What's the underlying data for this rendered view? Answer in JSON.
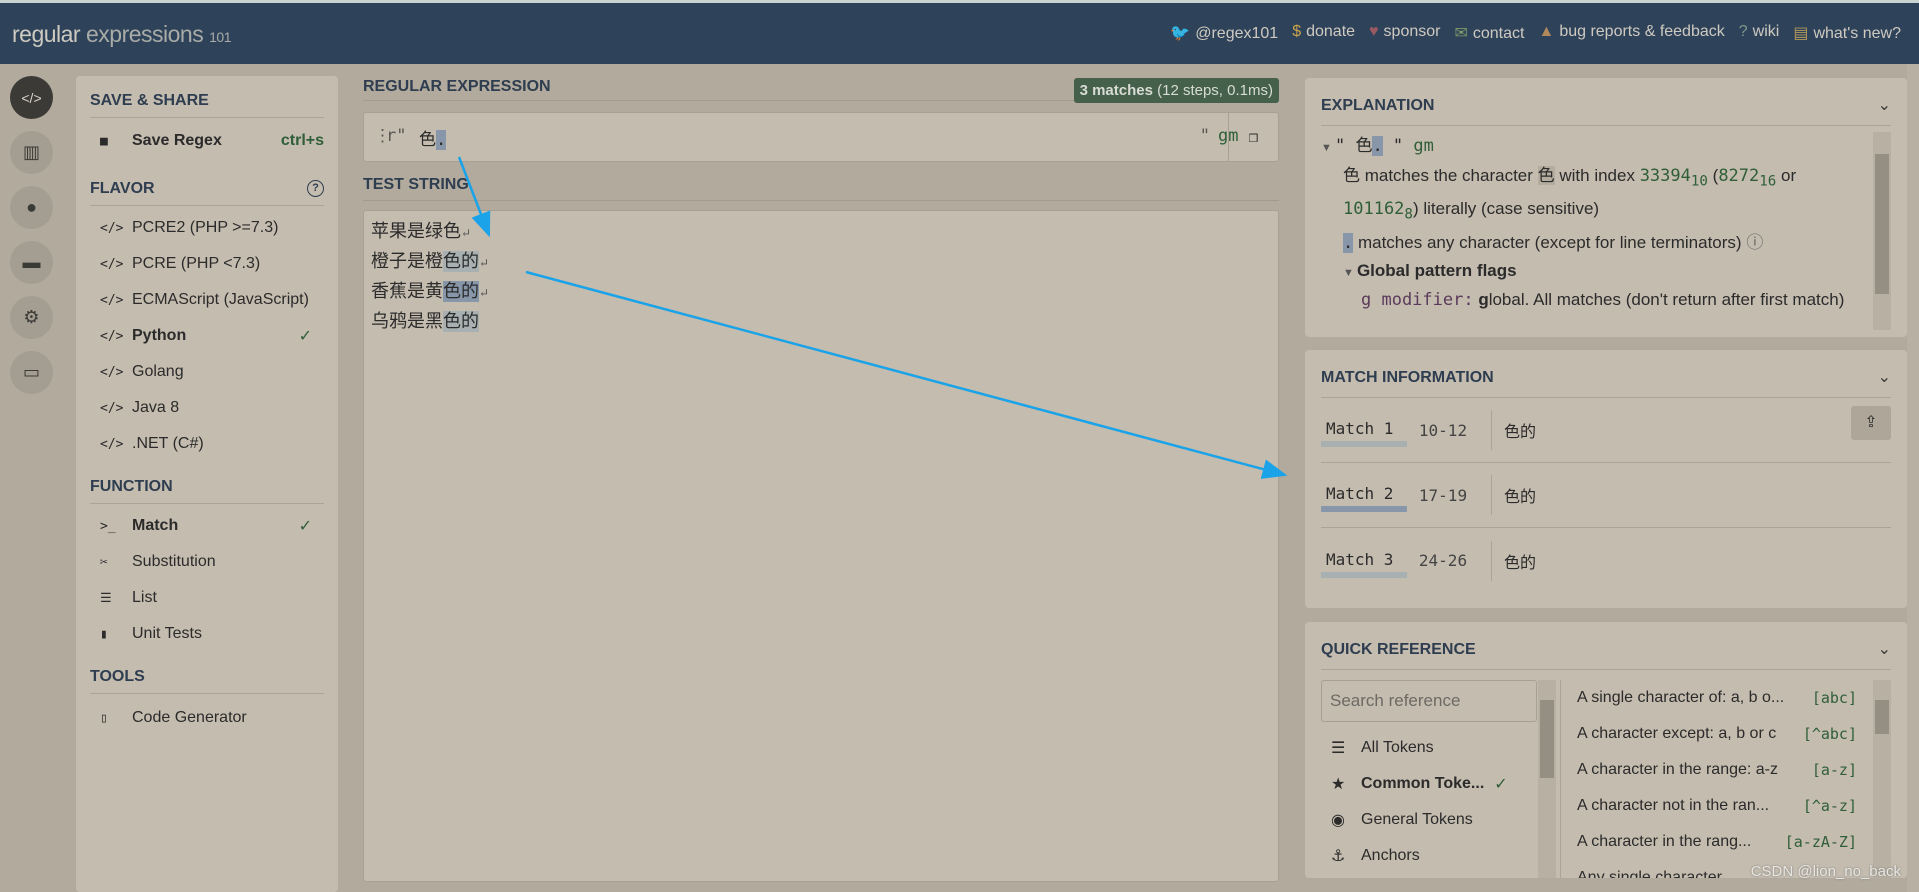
{
  "header": {
    "logo_a": "regular",
    "logo_b": "expressions",
    "logo_c": "101",
    "nav": [
      {
        "icon": "twitter-icon",
        "glyph": "🐦",
        "label": "@regex101",
        "color": "#8aa0b8"
      },
      {
        "icon": "dollar-icon",
        "glyph": "$",
        "label": "donate",
        "color": "#c9a14a"
      },
      {
        "icon": "heart-icon",
        "glyph": "♥",
        "label": "sponsor",
        "color": "#9a5a62"
      },
      {
        "icon": "mail-icon",
        "glyph": "✉",
        "label": "contact",
        "color": "#7d9a6a"
      },
      {
        "icon": "warning-icon",
        "glyph": "▲",
        "label": "bug reports & feedback",
        "color": "#b08a5c"
      },
      {
        "icon": "help-icon",
        "glyph": "?",
        "label": "wiki",
        "color": "#7d9a8a"
      },
      {
        "icon": "news-icon",
        "glyph": "▤",
        "label": "what's new?",
        "color": "#b59a5a"
      }
    ]
  },
  "rail": [
    {
      "icon": "code-icon",
      "glyph": "</>"
    },
    {
      "icon": "library-icon",
      "glyph": "▥"
    },
    {
      "icon": "user-icon",
      "glyph": "●"
    },
    {
      "icon": "gamepad-icon",
      "glyph": "▬"
    },
    {
      "icon": "settings-gear-icon",
      "glyph": "⚙"
    },
    {
      "icon": "chat-icon",
      "glyph": "▭"
    }
  ],
  "sidebar": {
    "save_share": "SAVE & SHARE",
    "save_label": "Save Regex",
    "save_shortcut": "ctrl+s",
    "flavor": "FLAVOR",
    "flavors": [
      {
        "label": "PCRE2 (PHP >=7.3)"
      },
      {
        "label": "PCRE (PHP <7.3)"
      },
      {
        "label": "ECMAScript (JavaScript)"
      },
      {
        "label": "Python",
        "selected": true
      },
      {
        "label": "Golang"
      },
      {
        "label": "Java 8"
      },
      {
        "label": ".NET (C#)"
      }
    ],
    "function": "FUNCTION",
    "functions": [
      {
        "label": "Match",
        "icon": "terminal-icon",
        "glyph": ">_",
        "selected": true
      },
      {
        "label": "Substitution",
        "icon": "scissors-icon",
        "glyph": "✂"
      },
      {
        "label": "List",
        "icon": "list-icon",
        "glyph": "☰"
      },
      {
        "label": "Unit Tests",
        "icon": "test-tube-icon",
        "glyph": "▮"
      }
    ],
    "tools": "TOOLS",
    "code_generator": "Code Generator"
  },
  "regex": {
    "title": "REGULAR EXPRESSION",
    "badge_count": "3 matches",
    "badge_detail": "(12 steps, 0.1ms)",
    "prefix": "r\"",
    "pattern_literal": "色",
    "pattern_dot": ".",
    "suffix": "\"",
    "flags": "gm"
  },
  "test": {
    "title": "TEST STRING",
    "lines": [
      {
        "pre": "苹果是绿色",
        "match": "",
        "newline": "↵",
        "match_style": ""
      },
      {
        "pre": "橙子是橙",
        "match": "色的",
        "newline": "↵",
        "match_style": "hl2"
      },
      {
        "pre": "香蕉是黄",
        "match": "色的",
        "newline": "↵",
        "match_style": "hl"
      },
      {
        "pre": "乌鸦是黑",
        "match": "色的",
        "newline": "",
        "match_style": "hl2"
      }
    ]
  },
  "explanation": {
    "title": "EXPLANATION",
    "q1": "\" ",
    "lit": "色",
    "dot": ".",
    "q2": " \" ",
    "flags": "gm",
    "l1a": "色",
    "l1b": " matches the character ",
    "l1c": "色",
    "l1d": " with index ",
    "n1": "33394",
    "s1": "10",
    "p1": " (",
    "n2": "8272",
    "s2": "16",
    "or": " or",
    "n3": "101162",
    "s3": "8",
    "l2": ") literally (case sensitive)",
    "dot_desc": " matches any character (except for line terminators)",
    "flags_title": "Global pattern flags",
    "g_mod": "g modifier:",
    "g_bold": " g",
    "g_rest": "lobal. All matches (don't return after first match)"
  },
  "match_info": {
    "title": "MATCH INFORMATION",
    "matches": [
      {
        "name": "Match 1",
        "range": "10-12",
        "text": "色的"
      },
      {
        "name": "Match 2",
        "range": "17-19",
        "text": "色的"
      },
      {
        "name": "Match 3",
        "range": "24-26",
        "text": "色的"
      }
    ]
  },
  "quick_ref": {
    "title": "QUICK REFERENCE",
    "search_placeholder": "Search reference",
    "categories": [
      {
        "label": "All Tokens",
        "glyph": "☰",
        "icon": "stack-icon"
      },
      {
        "label": "Common Toke...",
        "glyph": "★",
        "icon": "star-icon",
        "selected": true
      },
      {
        "label": "General Tokens",
        "glyph": "◉",
        "icon": "target-icon"
      },
      {
        "label": "Anchors",
        "glyph": "⚓",
        "icon": "anchor-icon"
      }
    ],
    "items": [
      {
        "desc": "A single character of: a, b o...",
        "token": "[abc]"
      },
      {
        "desc": "A character except: a, b or c",
        "token": "[^abc]"
      },
      {
        "desc": "A character in the range: a-z",
        "token": "[a-z]"
      },
      {
        "desc": "A character not in the ran...",
        "token": "[^a-z]"
      },
      {
        "desc": "A character in the rang...",
        "token": "[a-zA-Z]"
      },
      {
        "desc": "Any single character",
        "token": ""
      }
    ]
  },
  "watermark": "CSDN @lion_no_back",
  "colors": {
    "header": "#2e425a",
    "panel": "#c4bcaf",
    "accent_green": "#45604b",
    "match_highlight": "#8796a8",
    "annotation_arrow": "#1aa3e8"
  }
}
